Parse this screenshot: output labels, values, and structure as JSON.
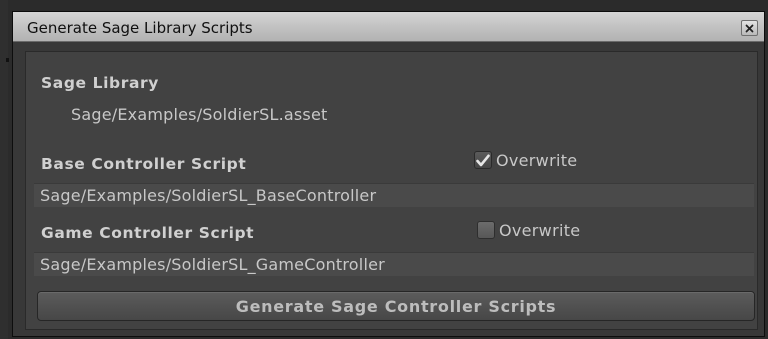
{
  "window": {
    "title": "Generate Sage Library Scripts",
    "close_icon": "close-icon"
  },
  "sage_library": {
    "heading": "Sage Library",
    "path": "Sage/Examples/SoldierSL.asset"
  },
  "base_controller": {
    "heading": "Base Controller Script",
    "overwrite_label": "Overwrite",
    "overwrite_checked": true,
    "path": "Sage/Examples/SoldierSL_BaseController"
  },
  "game_controller": {
    "heading": "Game Controller Script",
    "overwrite_label": "Overwrite",
    "overwrite_checked": false,
    "path": "Sage/Examples/SoldierSL_GameController"
  },
  "generate_button": {
    "label": "Generate Sage Controller Scripts"
  },
  "colors": {
    "panel": "#383838",
    "titlebar": "#c4c4c4",
    "text": "#c8c8c8",
    "field": "#4a4a4a"
  }
}
